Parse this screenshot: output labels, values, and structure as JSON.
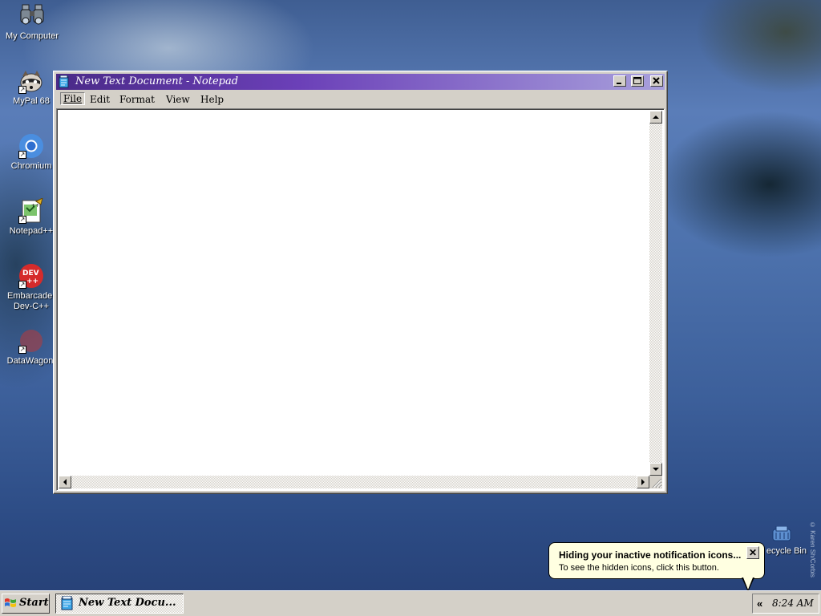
{
  "desktop": {
    "icons": [
      {
        "label": "My Computer",
        "icon": "binoculars-icon"
      },
      {
        "label": "MyPal 68",
        "icon": "raccoon-icon"
      },
      {
        "label": "Chromium",
        "icon": "chromium-icon"
      },
      {
        "label": "Notepad++",
        "icon": "notepadpp-icon"
      },
      {
        "label": "Embarcader\nDev-C++",
        "icon": "devcpp-icon"
      },
      {
        "label": "DataWagon.",
        "icon": "datawagon-icon"
      }
    ],
    "recycle_bin": {
      "label": "ecycle Bin",
      "icon": "recycle-bin-icon"
    },
    "watermark": "© Karen Sh/Corbis"
  },
  "window": {
    "title": "New Text Document - Notepad",
    "menu": [
      "File",
      "Edit",
      "Format",
      "View",
      "Help"
    ],
    "content": ""
  },
  "taskbar": {
    "start_label": "Start",
    "task_label": "New Text Docu...",
    "tray_chevron": "«",
    "clock": "8:24 AM"
  },
  "balloon": {
    "title": "Hiding your inactive notification icons...",
    "text": "To see the hidden icons, click this button.",
    "close": "✕"
  },
  "colors": {
    "titlebar_start": "#4a2a88",
    "titlebar_end": "#a8a0dc",
    "face": "#d4d0c8",
    "balloon": "#ffffe1"
  }
}
